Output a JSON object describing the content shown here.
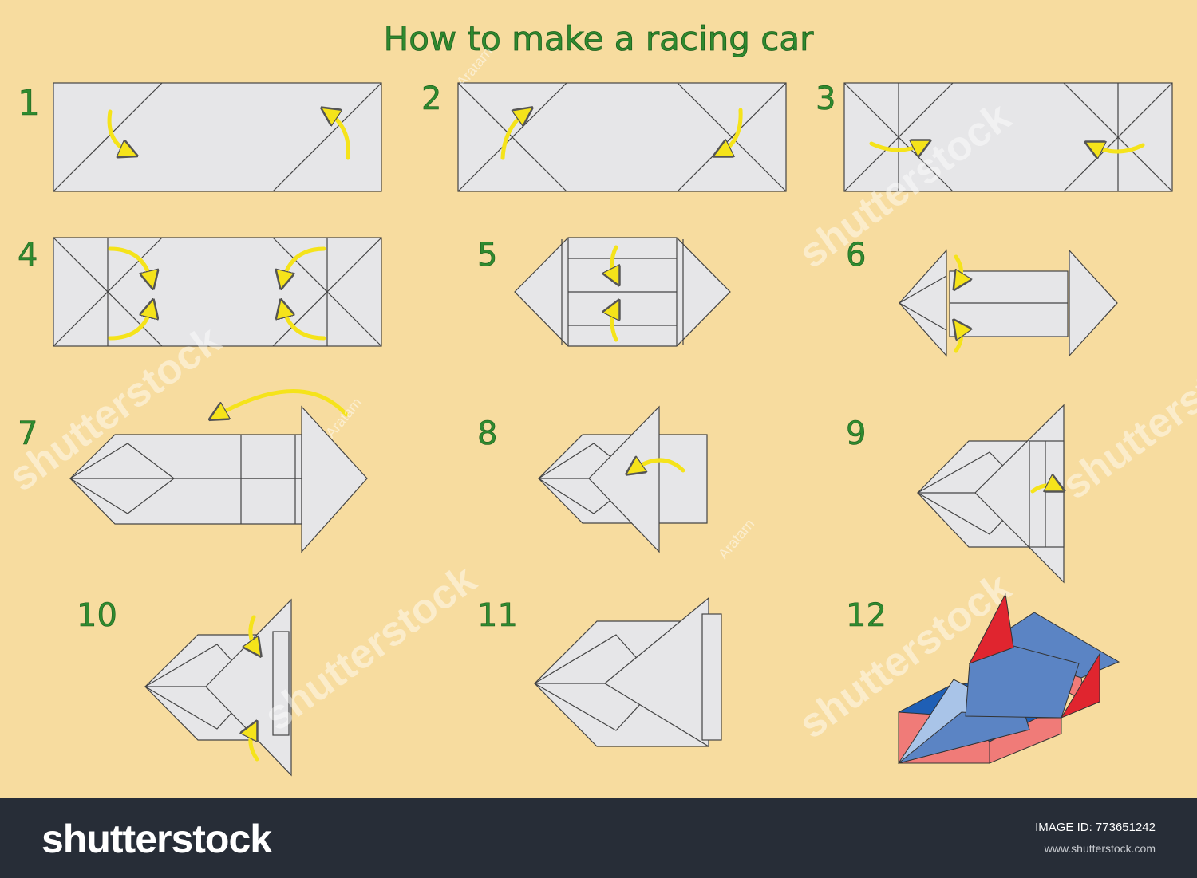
{
  "title": "How to make a racing car",
  "steps": [
    {
      "number": "1"
    },
    {
      "number": "2"
    },
    {
      "number": "3"
    },
    {
      "number": "4"
    },
    {
      "number": "5"
    },
    {
      "number": "6"
    },
    {
      "number": "7"
    },
    {
      "number": "8"
    },
    {
      "number": "9"
    },
    {
      "number": "10"
    },
    {
      "number": "11"
    },
    {
      "number": "12"
    }
  ],
  "watermarks": {
    "brand": "shutterstock",
    "author": "Aratarn"
  },
  "footer": {
    "logo_text": "shutterstock",
    "image_id": "IMAGE ID: 773651242",
    "site": "www.shutterstock.com"
  },
  "colors": {
    "background": "#f7dc9f",
    "paper": "#e6e6e8",
    "arrow": "#f5e31a",
    "car_blue": "#5b84c4",
    "car_red": "#e0252f",
    "car_pink": "#f07b78",
    "title_green": "#2f8a2f",
    "footer": "#272d37"
  }
}
